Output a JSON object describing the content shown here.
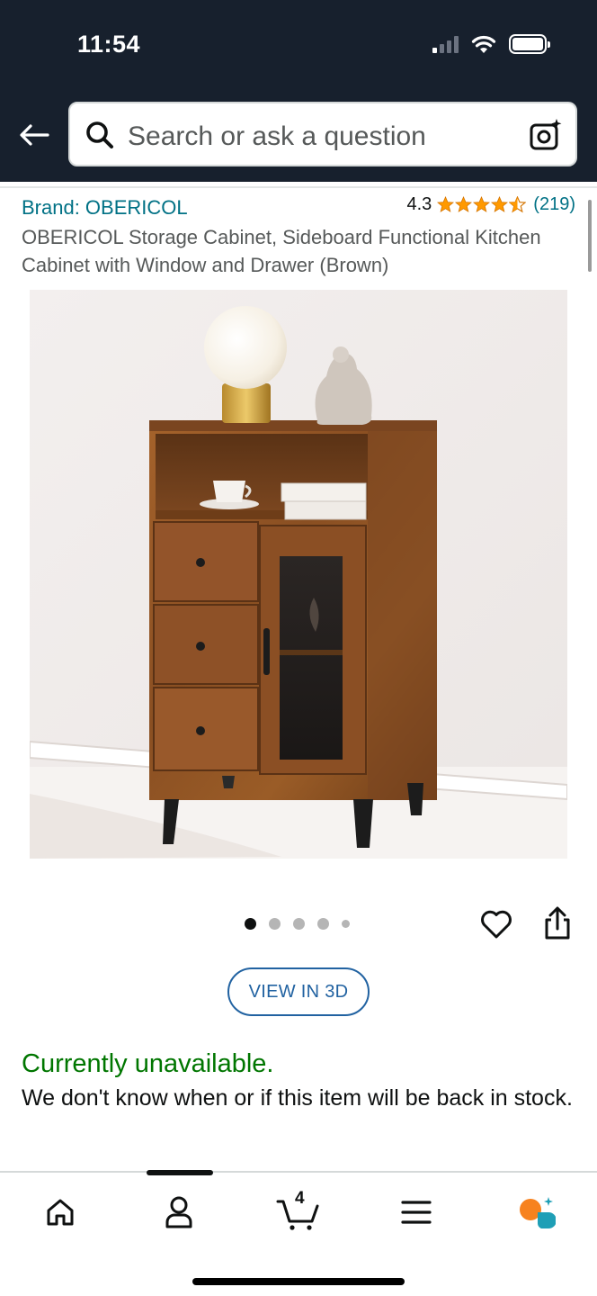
{
  "status_bar": {
    "time": "11:54"
  },
  "search": {
    "placeholder": "Search or ask a question"
  },
  "product": {
    "brand": "Brand: OBERICOL",
    "rating": "4.3",
    "review_count": "(219)",
    "title": "OBERICOL Storage Cabinet, Sideboard Functional Kitchen Cabinet with Window and Drawer (Brown)"
  },
  "gallery": {
    "image_count": 5,
    "active_index": 0
  },
  "actions": {
    "view_3d_label": "VIEW IN 3D"
  },
  "availability": {
    "status": "Currently unavailable.",
    "message": "We don't know when or if this item will be back in stock."
  },
  "tabbar": {
    "items": [
      "home",
      "account",
      "cart",
      "menu",
      "rufus"
    ],
    "cart_count": "4",
    "active": "account"
  },
  "colors": {
    "header_bg": "#17202d",
    "link": "#007185",
    "star": "#ff9900",
    "available_green": "#007600",
    "button_blue": "#2162a1",
    "rufus_orange": "#f7821e",
    "rufus_teal": "#1f9fb6"
  }
}
